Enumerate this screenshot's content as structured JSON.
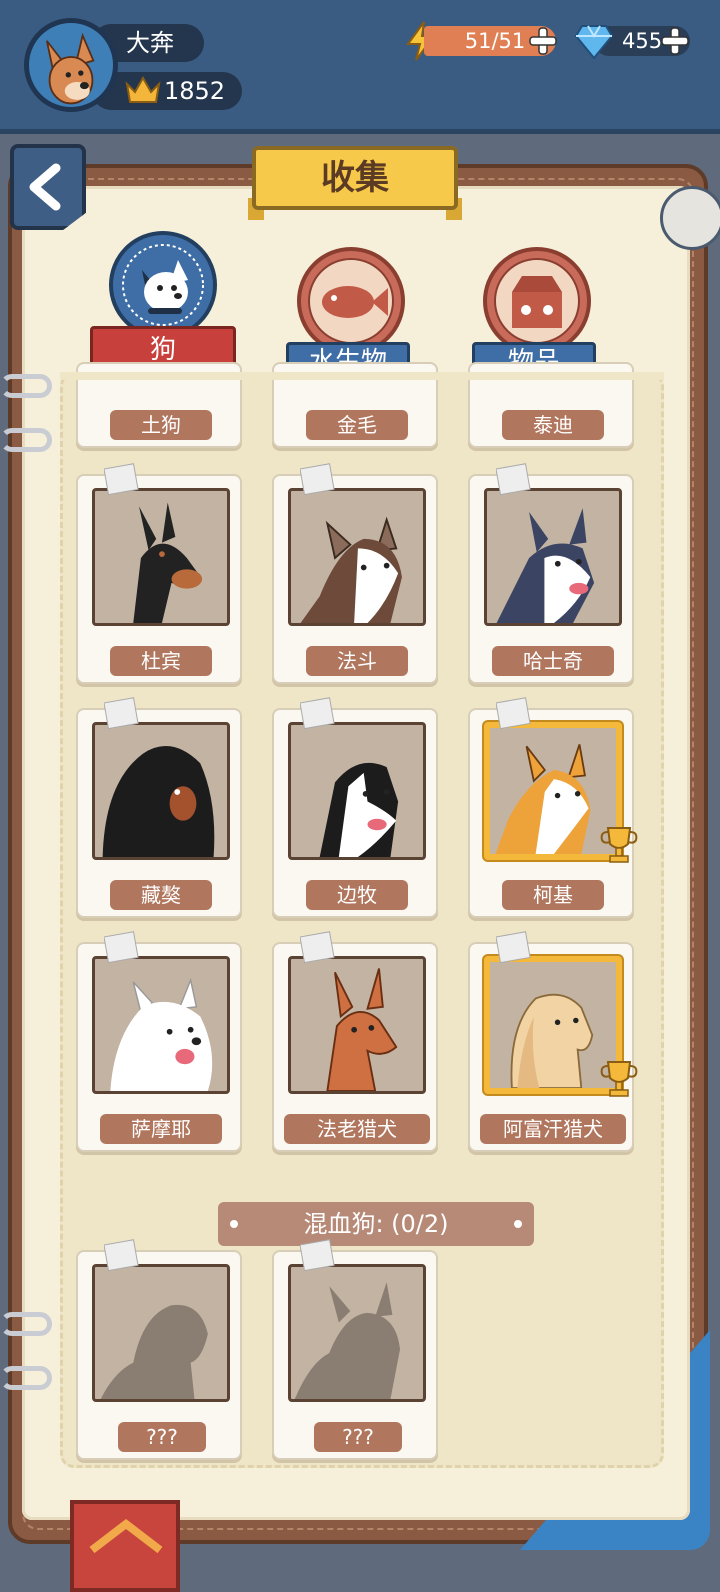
{
  "player": {
    "name": "大奔",
    "trophies": "1852",
    "energy": "51/51",
    "gems": "455"
  },
  "header": {
    "title": "收集"
  },
  "tabs": [
    {
      "label": "狗",
      "active": true
    },
    {
      "label": "水生物",
      "active": false
    },
    {
      "label": "物品",
      "active": false
    }
  ],
  "cards": [
    {
      "label": "土狗"
    },
    {
      "label": "金毛"
    },
    {
      "label": "泰迪"
    },
    {
      "label": "杜宾",
      "gold": false
    },
    {
      "label": "法斗",
      "gold": false
    },
    {
      "label": "哈士奇",
      "gold": false
    },
    {
      "label": "藏獒",
      "gold": false
    },
    {
      "label": "边牧",
      "gold": false
    },
    {
      "label": "柯基",
      "gold": true
    },
    {
      "label": "萨摩耶",
      "gold": false
    },
    {
      "label": "法老猎犬",
      "gold": false
    },
    {
      "label": "阿富汗猎犬",
      "gold": true
    }
  ],
  "mixed_section": {
    "title": "混血狗: (0/2)",
    "cards": [
      {
        "label": "???"
      },
      {
        "label": "???"
      }
    ]
  },
  "colors": {
    "topbar": "#3b5c82",
    "page": "#f6efd9",
    "book_cover": "#8a5a42",
    "active_tab": "#c8403b",
    "inactive_tab": "#3e6ea5",
    "gold_frame": "#f4b93a",
    "label_bg": "#b0775e"
  },
  "icons": [
    "bolt-icon",
    "gem-icon",
    "crown-icon",
    "plus-icon",
    "back-icon",
    "trophy-icon",
    "note-icon",
    "dog-icon",
    "fish-icon",
    "box-icon"
  ]
}
